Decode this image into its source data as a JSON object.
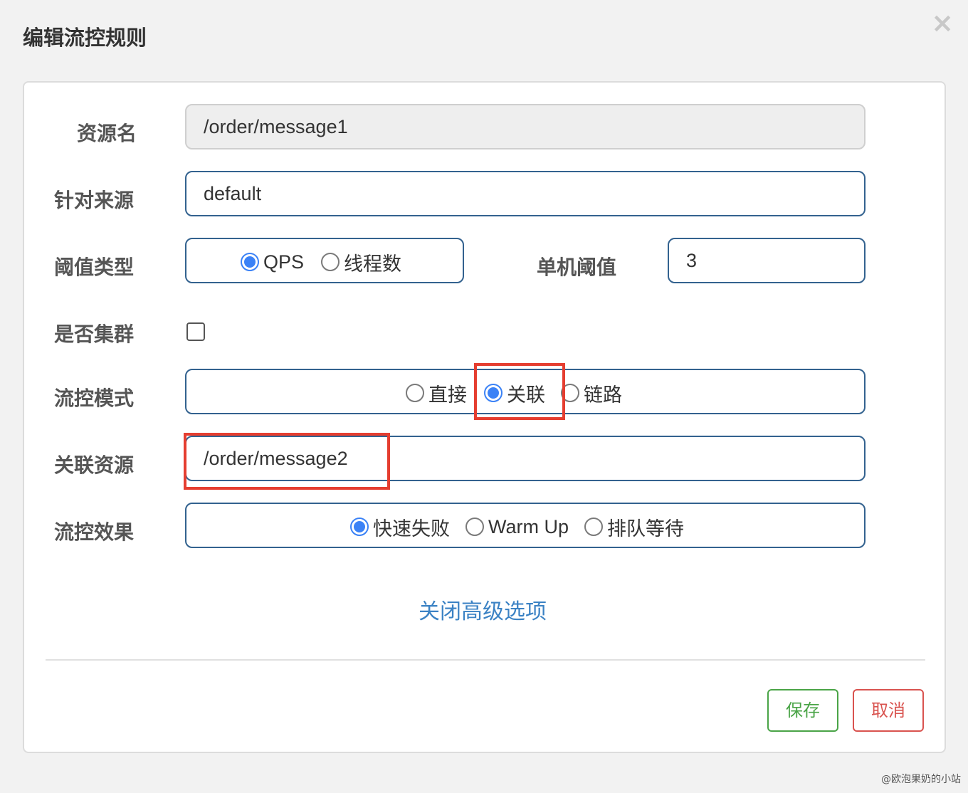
{
  "dialog": {
    "title": "编辑流控规则",
    "close_icon": "×"
  },
  "form": {
    "resource_name": {
      "label": "资源名",
      "value": "/order/message1"
    },
    "limit_app": {
      "label": "针对来源",
      "value": "default"
    },
    "grade": {
      "label": "阈值类型",
      "options": [
        "QPS",
        "线程数"
      ],
      "selected": "QPS"
    },
    "count": {
      "label": "单机阈值",
      "value": "3"
    },
    "cluster_mode": {
      "label": "是否集群",
      "checked": false
    },
    "strategy": {
      "label": "流控模式",
      "options": [
        "直接",
        "关联",
        "链路"
      ],
      "selected": "关联"
    },
    "ref_resource": {
      "label": "关联资源",
      "value": "/order/message2"
    },
    "control_behavior": {
      "label": "流控效果",
      "options": [
        "快速失败",
        "Warm Up",
        "排队等待"
      ],
      "selected": "快速失败"
    }
  },
  "advanced_link": "关闭高级选项",
  "buttons": {
    "save": "保存",
    "cancel": "取消"
  },
  "watermark": "@欧泡果奶的小站",
  "colors": {
    "accent": "#3b82f6",
    "highlight": "#e53e30",
    "save": "#4aa447",
    "cancel": "#d9534f"
  }
}
